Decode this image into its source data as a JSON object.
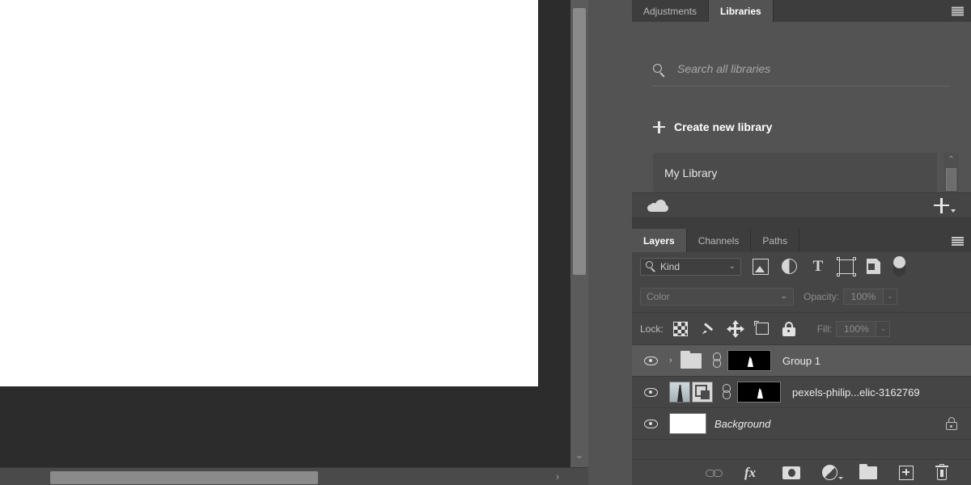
{
  "canvas": {
    "document_background": "#ffffff",
    "workspace_background": "#2c2c2c",
    "vertical_scrollbar_name": "canvas-vertical-scrollbar",
    "horizontal_scrollbar_name": "canvas-horizontal-scrollbar",
    "down_chevron": "⌄",
    "right_chevron": "›"
  },
  "libraries_panel": {
    "tabs": [
      {
        "label": "Adjustments",
        "active": false
      },
      {
        "label": "Libraries",
        "active": true
      }
    ],
    "menu_icon": "hamburger-menu-icon",
    "search": {
      "placeholder": "Search all libraries",
      "icon": "search-icon",
      "value": ""
    },
    "create_new": {
      "label": "Create new library",
      "icon": "plus-icon"
    },
    "items": [
      {
        "name": "My Library"
      },
      {
        "name": ""
      }
    ],
    "scrollbar": {
      "up_arrow": "⌃",
      "down_arrow": "⌄"
    },
    "footer": {
      "cloud_icon": "cloud-sync-icon",
      "add_icon": "add-content-plus-icon"
    }
  },
  "layers_panel": {
    "tabs": [
      {
        "label": "Layers",
        "active": true
      },
      {
        "label": "Channels",
        "active": false
      },
      {
        "label": "Paths",
        "active": false
      }
    ],
    "menu_icon": "hamburger-menu-icon",
    "filter": {
      "kind_label": "Kind",
      "kind_caret": "⌄",
      "icons": [
        "filter-pixel-layers-icon",
        "filter-adjustment-layers-icon",
        "filter-type-layers-icon",
        "filter-shape-layers-icon",
        "filter-smart-object-icon"
      ],
      "type_glyph": "T",
      "toggle_name": "filter-enable-toggle"
    },
    "blend": {
      "mode": "Color",
      "mode_caret": "⌄",
      "opacity_label": "Opacity:",
      "opacity_value": "100%",
      "opacity_caret": "⌄"
    },
    "lock": {
      "label": "Lock:",
      "icons": [
        "lock-transparent-pixels-icon",
        "lock-image-pixels-icon",
        "lock-position-icon",
        "lock-artboard-nesting-icon",
        "lock-all-icon"
      ],
      "fill_label": "Fill:",
      "fill_value": "100%",
      "fill_caret": "⌄"
    },
    "layers": [
      {
        "name": "Group 1",
        "type": "group",
        "selected": true,
        "visible": true,
        "expand_chevron": "›",
        "linked": true,
        "has_mask": true,
        "locked": false,
        "italic": false
      },
      {
        "name": "pexels-philip...elic-3162769",
        "type": "smart-object",
        "selected": false,
        "visible": true,
        "linked": true,
        "has_mask": true,
        "locked": false,
        "italic": false
      },
      {
        "name": "Background",
        "type": "background",
        "selected": false,
        "visible": true,
        "linked": false,
        "has_mask": false,
        "locked": true,
        "italic": true
      }
    ],
    "toolbar": [
      "link-layers-icon",
      "add-layer-style-fx-icon",
      "add-layer-mask-icon",
      "new-adjustment-layer-icon",
      "new-group-icon",
      "new-layer-icon",
      "delete-layer-icon"
    ],
    "fx_glyph": "fx"
  },
  "colors": {
    "panel_bg": "#454545",
    "panel_bg_light": "#535353",
    "tabbar_bg": "#3d3d3d",
    "row_selected": "#5a5a5a",
    "text_primary": "#eaeaea",
    "text_muted": "#8c8c8c",
    "canvas_white": "#ffffff"
  }
}
